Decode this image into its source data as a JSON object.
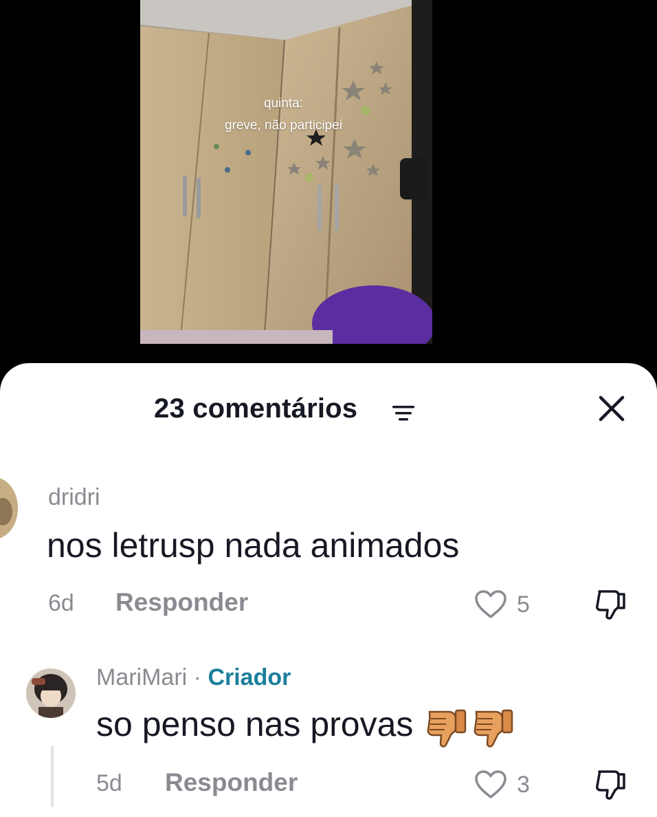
{
  "video": {
    "overlay_line1": "quinta:",
    "overlay_line2": "greve, não participei"
  },
  "comments_panel": {
    "title": "23 comentários",
    "filter_icon": "sort-lines-icon",
    "close_icon": "close-icon"
  },
  "comments": [
    {
      "username": "dridri",
      "text": "nos letrusp nada animados",
      "age": "6d",
      "reply_label": "Responder",
      "likes": "5"
    },
    {
      "username": "MariMari",
      "separator": " · ",
      "badge": "Criador",
      "text": "so penso nas provas",
      "emoji": "thumbs-down-emoji x2",
      "age": "5d",
      "reply_label": "Responder",
      "likes": "3"
    }
  ],
  "colors": {
    "primary_text": "#161823",
    "secondary_text": "#8a8b91",
    "creator_badge": "#1b7f9c"
  }
}
